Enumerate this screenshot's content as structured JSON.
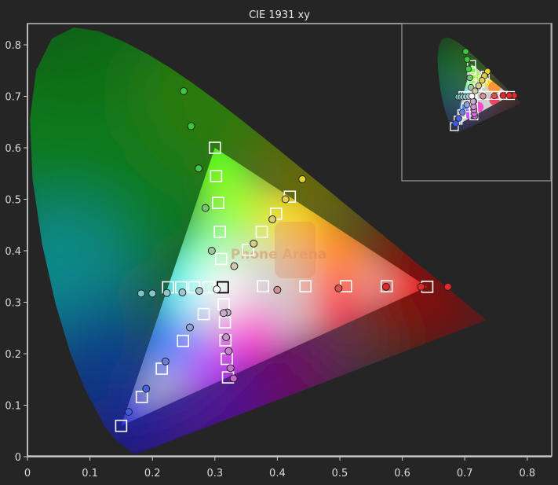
{
  "chart_data": {
    "type": "scatter",
    "title": "CIE 1931 xy",
    "xlabel": "",
    "ylabel": "",
    "xlim": [
      0,
      0.84
    ],
    "ylim": [
      0,
      0.84
    ],
    "x_ticks": [
      0,
      0.1,
      0.2,
      0.3,
      0.4,
      0.5,
      0.6,
      0.7,
      0.8
    ],
    "y_ticks": [
      0,
      0.1,
      0.2,
      0.3,
      0.4,
      0.5,
      0.6,
      0.7,
      0.8
    ],
    "x_tick_labels": [
      "0",
      "0.1",
      "0.2",
      "0.3",
      "0.4",
      "0.5",
      "0.6",
      "0.7",
      "0.8"
    ],
    "y_tick_labels": [
      "0",
      "0.1",
      "0.2",
      "0.3",
      "0.4",
      "0.5",
      "0.6",
      "0.7",
      "0.8"
    ],
    "grid": false,
    "inset": true,
    "watermark": "Phone Arena",
    "colors": {
      "background": "#252525",
      "axis": "#cfcfcf",
      "target_marker": "#ffffff",
      "gamut_red": "#ff0000",
      "gamut_green": "#00ff00",
      "gamut_blue": "#0000ff"
    },
    "gamut_triangle": [
      {
        "x": 0.64,
        "y": 0.33
      },
      {
        "x": 0.3,
        "y": 0.6
      },
      {
        "x": 0.15,
        "y": 0.06
      }
    ],
    "white_point": {
      "x": 0.3127,
      "y": 0.329
    },
    "series": [
      {
        "marker": "square",
        "points": [
          {
            "x": 0.64,
            "y": 0.33
          },
          {
            "x": 0.575,
            "y": 0.331
          },
          {
            "x": 0.51,
            "y": 0.331
          },
          {
            "x": 0.445,
            "y": 0.331
          },
          {
            "x": 0.377,
            "y": 0.331
          },
          {
            "x": 0.3,
            "y": 0.6
          },
          {
            "x": 0.302,
            "y": 0.545
          },
          {
            "x": 0.305,
            "y": 0.493
          },
          {
            "x": 0.308,
            "y": 0.437
          },
          {
            "x": 0.31,
            "y": 0.384
          },
          {
            "x": 0.15,
            "y": 0.06
          },
          {
            "x": 0.183,
            "y": 0.116
          },
          {
            "x": 0.215,
            "y": 0.171
          },
          {
            "x": 0.249,
            "y": 0.225
          },
          {
            "x": 0.282,
            "y": 0.277
          },
          {
            "x": 0.225,
            "y": 0.329
          },
          {
            "x": 0.246,
            "y": 0.329
          },
          {
            "x": 0.267,
            "y": 0.329
          },
          {
            "x": 0.29,
            "y": 0.329
          },
          {
            "x": 0.321,
            "y": 0.154
          },
          {
            "x": 0.319,
            "y": 0.19
          },
          {
            "x": 0.317,
            "y": 0.226
          },
          {
            "x": 0.316,
            "y": 0.261
          },
          {
            "x": 0.314,
            "y": 0.296
          },
          {
            "x": 0.42,
            "y": 0.505
          },
          {
            "x": 0.398,
            "y": 0.472
          },
          {
            "x": 0.375,
            "y": 0.437
          },
          {
            "x": 0.353,
            "y": 0.402
          },
          {
            "x": 0.3127,
            "y": 0.329
          }
        ]
      },
      {
        "marker": "circle",
        "points": [
          {
            "x": 0.673,
            "y": 0.33
          },
          {
            "x": 0.63,
            "y": 0.33
          },
          {
            "x": 0.574,
            "y": 0.33
          },
          {
            "x": 0.498,
            "y": 0.327
          },
          {
            "x": 0.4,
            "y": 0.324
          },
          {
            "x": 0.25,
            "y": 0.71
          },
          {
            "x": 0.262,
            "y": 0.642
          },
          {
            "x": 0.274,
            "y": 0.56
          },
          {
            "x": 0.285,
            "y": 0.483
          },
          {
            "x": 0.295,
            "y": 0.4
          },
          {
            "x": 0.162,
            "y": 0.087
          },
          {
            "x": 0.19,
            "y": 0.132
          },
          {
            "x": 0.221,
            "y": 0.185
          },
          {
            "x": 0.26,
            "y": 0.251
          },
          {
            "x": 0.32,
            "y": 0.28
          },
          {
            "x": 0.182,
            "y": 0.317
          },
          {
            "x": 0.2,
            "y": 0.317
          },
          {
            "x": 0.223,
            "y": 0.318
          },
          {
            "x": 0.248,
            "y": 0.319
          },
          {
            "x": 0.275,
            "y": 0.322
          },
          {
            "x": 0.33,
            "y": 0.152
          },
          {
            "x": 0.325,
            "y": 0.172
          },
          {
            "x": 0.322,
            "y": 0.205
          },
          {
            "x": 0.318,
            "y": 0.232
          },
          {
            "x": 0.314,
            "y": 0.279
          },
          {
            "x": 0.44,
            "y": 0.539
          },
          {
            "x": 0.413,
            "y": 0.5
          },
          {
            "x": 0.392,
            "y": 0.461
          },
          {
            "x": 0.362,
            "y": 0.414
          },
          {
            "x": 0.331,
            "y": 0.37
          },
          {
            "x": 0.303,
            "y": 0.325
          }
        ]
      }
    ]
  }
}
